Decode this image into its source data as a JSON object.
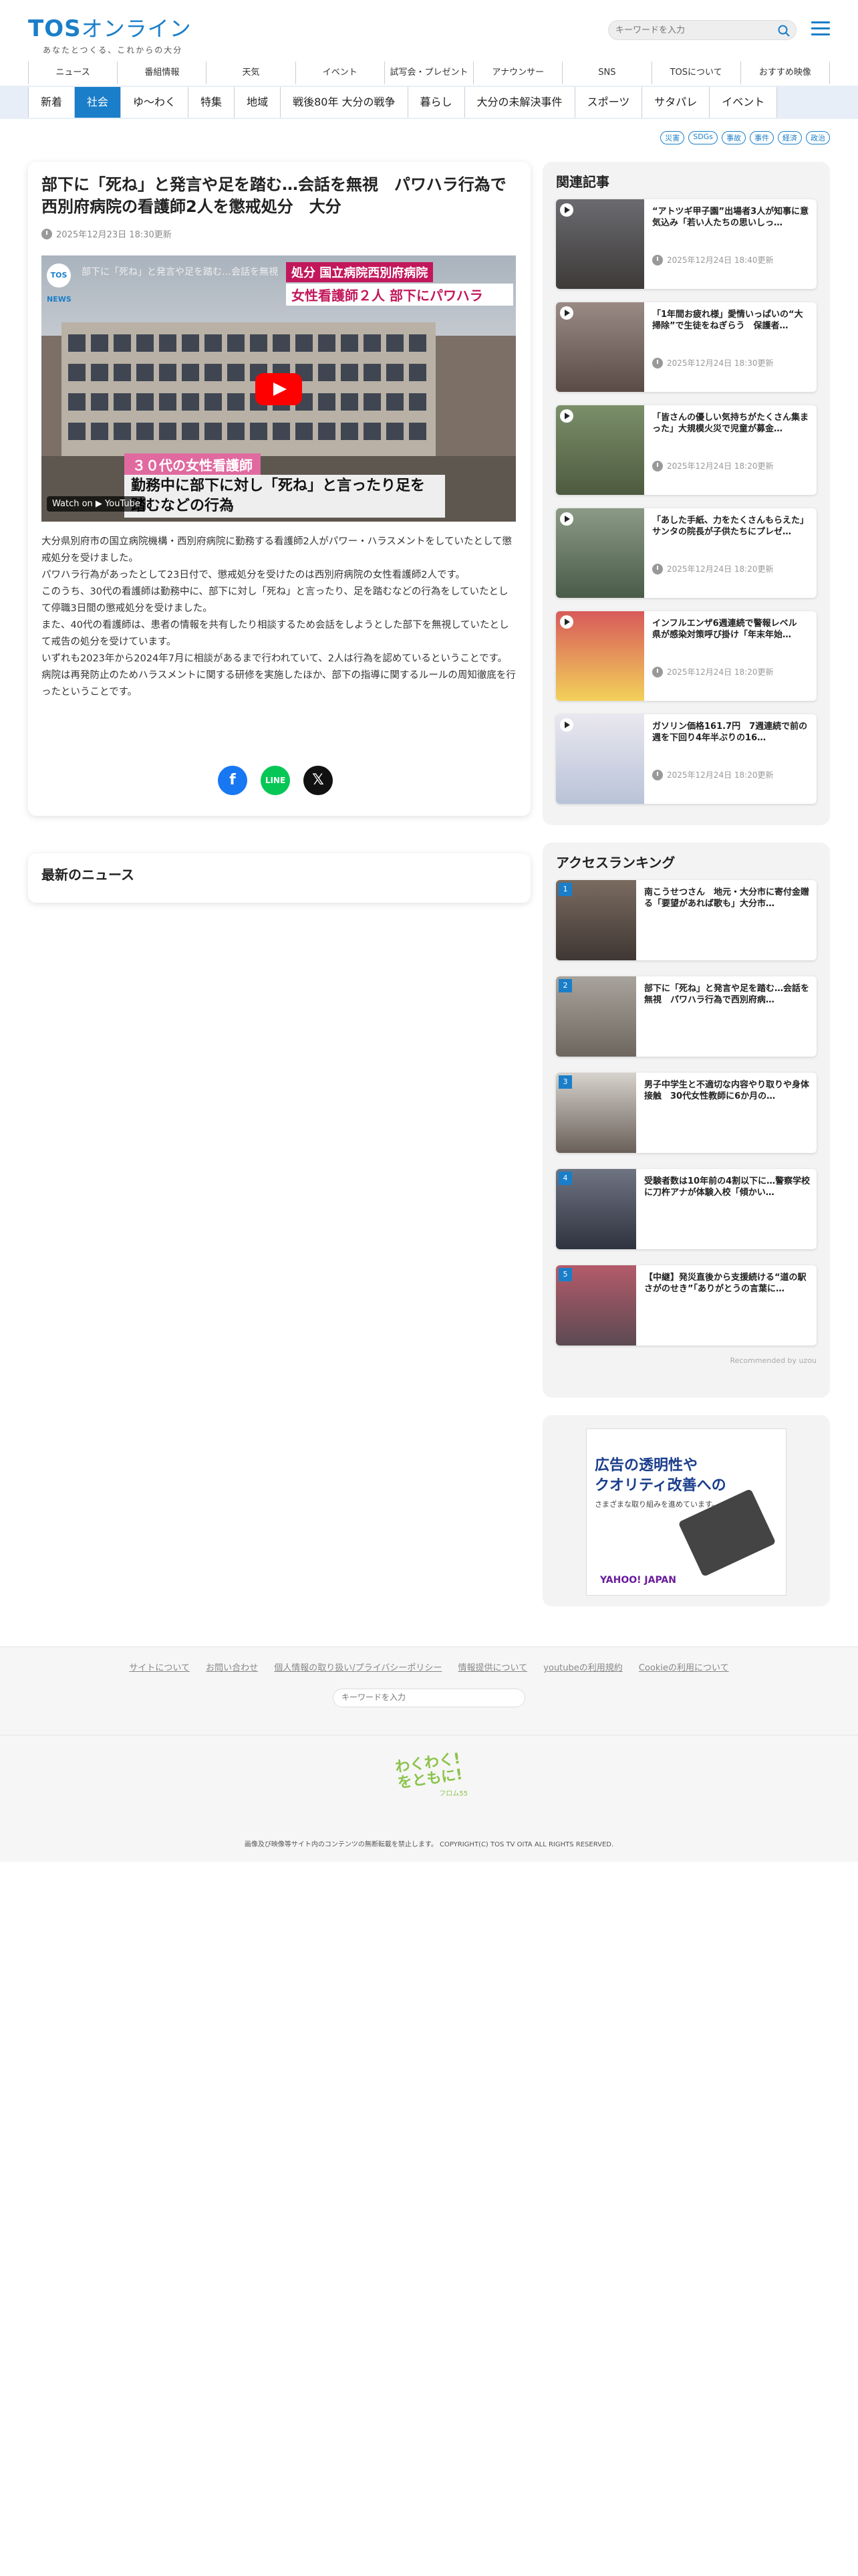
{
  "site": {
    "logo_main": "TOS",
    "logo_kana": "オンライン",
    "logo_tagline": "あなたとつくる、これからの大分",
    "search_placeholder": "キーワードを入力"
  },
  "global_nav": [
    "ニュース",
    "番組情報",
    "天気",
    "イベント",
    "試写会・プレゼント",
    "アナウンサー",
    "SNS",
    "TOSについて",
    "おすすめ映像"
  ],
  "category_nav": {
    "items": [
      "新着",
      "社会",
      "ゆ〜わく",
      "特集",
      "地域",
      "戦後80年 大分の戦争",
      "暮らし",
      "大分の未解決事件",
      "スポーツ",
      "サタパレ",
      "イベント"
    ],
    "active": "社会"
  },
  "tags": [
    "災害",
    "SDGs",
    "事故",
    "事件",
    "経済",
    "政治"
  ],
  "article": {
    "title": "部下に「死ね」と発言や足を踏む…会話を無視　パワハラ行為で西別府病院の看護師2人を懲戒処分　大分",
    "date": "2025年12月23日 18:30更新",
    "video": {
      "title": "部下に「死ね」と発言や足を踏む…会話を無視",
      "badge_small": "処分",
      "badge_top": "国立病院西別府病院",
      "badge_main": "女性看護師２人 部下にパワハラ",
      "caption_top": "３０代の女性看護師",
      "caption_main": "勤務中に部下に対し「死ね」と言ったり足を踏むなどの行為",
      "watch_label": "Watch on ▶ YouTube",
      "channel": "TOS NEWS"
    },
    "paragraphs": [
      "大分県別府市の国立病院機構・西別府病院に勤務する看護師2人がパワー・ハラスメントをしていたとして懲戒処分を受けました。",
      "パワハラ行為があったとして23日付で、懲戒処分を受けたのは西別府病院の女性看護師2人です。",
      "このうち、30代の看護師は勤務中に、部下に対し「死ね」と言ったり、足を踏むなどの行為をしていたとして停職3日間の懲戒処分を受けました。",
      "また、40代の看護師は、患者の情報を共有したり相談するため会話をしようとした部下を無視していたとして戒告の処分を受けています。",
      "いずれも2023年から2024年7月に相談があるまで行われていて、2人は行為を認めているということです。",
      "病院は再発防止のためハラスメントに関する研修を実施したほか、部下の指導に関するルールの周知徹底を行ったということです。"
    ],
    "share": {
      "facebook": "f",
      "line": "LINE",
      "x": "𝕏"
    }
  },
  "latest": {
    "heading": "最新のニュース"
  },
  "related": {
    "heading": "関連記事",
    "items": [
      {
        "title": "“アトツギ甲子園”出場者3人が知事に意気込み「若い人たちの思いしっ…",
        "date": "2025年12月24日 18:40更新"
      },
      {
        "title": "「1年間お疲れ様」愛情いっぱいの“大掃除”で生徒をねぎらう　保護者…",
        "date": "2025年12月24日 18:30更新"
      },
      {
        "title": "「皆さんの優しい気持ちがたくさん集まった」大規模火災で児童が募金…",
        "date": "2025年12月24日 18:20更新"
      },
      {
        "title": "「あした手紙、力をたくさんもらえた」サンタの院長が子供たちにプレゼ…",
        "date": "2025年12月24日 18:20更新"
      },
      {
        "title": "インフルエンザ6週連続で警報レベル　県が感染対策呼び掛け「年末年始…",
        "date": "2025年12月24日 18:20更新"
      },
      {
        "title": "ガソリン価格161.7円　7週連続で前の週を下回り4年半ぶりの16…",
        "date": "2025年12月24日 18:20更新"
      }
    ]
  },
  "ranking": {
    "heading": "アクセスランキング",
    "items": [
      {
        "rank": "1",
        "title": "南こうせつさん　地元・大分市に寄付金贈る「要望があれば歌も」大分市…"
      },
      {
        "rank": "2",
        "title": "部下に「死ね」と発言や足を踏む…会話を無視　パワハラ行為で西別府病…"
      },
      {
        "rank": "3",
        "title": "男子中学生と不適切な内容やり取りや身体接触　30代女性教師に6か月の…"
      },
      {
        "rank": "4",
        "title": "受験者数は10年前の4割以下に…警察学校に刀杵アナが体験入校「傾かい…"
      },
      {
        "rank": "5",
        "title": "【中継】発災直後から支援続ける“道の駅さがのせき”「ありがとうの言葉に…"
      }
    ],
    "recommended": "Recommended by uzou"
  },
  "ad": {
    "line1": "広告の透明性や",
    "line2": "クオリティ改善への",
    "line3": "さまざまな取り組みを進めています。",
    "brand": "YAHOO! JAPAN"
  },
  "footer": {
    "links": [
      "サイトについて",
      "お問い合わせ",
      "個人情報の取り扱い/プライバシーポリシー",
      "情報提供について",
      "youtubeの利用規約",
      "Cookieの利用について"
    ],
    "search_placeholder": "キーワードを入力",
    "mascot_text": "わくわく!をともに!",
    "mascot_sub": "フロム55",
    "copyright": "画像及び映像等サイト内のコンテンツの無断転載を禁止します。 COPYRIGHT(C) TOS TV OITA ALL RIGHTS RESERVED."
  }
}
